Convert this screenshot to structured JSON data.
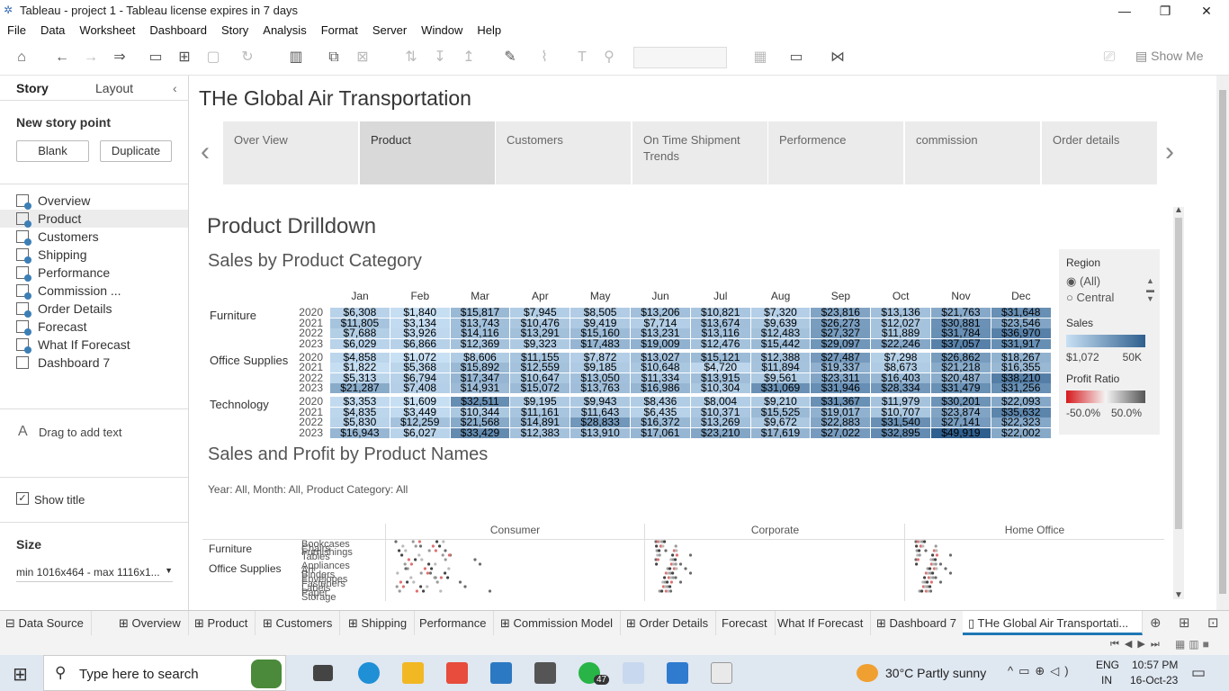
{
  "window": {
    "title": "Tableau - project 1 - Tableau license expires in 7 days",
    "minimize": "—",
    "restore": "❐",
    "close": "✕"
  },
  "menu": [
    "File",
    "Data",
    "Worksheet",
    "Dashboard",
    "Story",
    "Analysis",
    "Format",
    "Server",
    "Window",
    "Help"
  ],
  "toolbar": {
    "show_me": "Show Me"
  },
  "sidebar": {
    "tab_story": "Story",
    "tab_layout": "Layout",
    "collapse": "‹",
    "new_point": "New story point",
    "blank": "Blank",
    "duplicate": "Duplicate",
    "items": [
      "Overview",
      "Product",
      "Customers",
      "Shipping",
      "Performance",
      "Commission ...",
      "Order Details",
      "Forecast",
      "What If Forecast",
      "Dashboard 7"
    ],
    "drag_text": "Drag to add text",
    "show_title": "Show title",
    "size_label": "Size",
    "size_value": "min 1016x464 - max 1116x1..."
  },
  "story": {
    "title": "THe Global Air Transportation",
    "points": [
      {
        "label": "Over View"
      },
      {
        "label": "Product"
      },
      {
        "label": "Customers"
      },
      {
        "label": "On Time Shipment Trends"
      },
      {
        "label": "Performence"
      },
      {
        "label": "commission"
      },
      {
        "label": "Order details"
      }
    ],
    "prev": "‹",
    "next": "›"
  },
  "dashboard": {
    "title": "Product Drilldown",
    "heatmap_title": "Sales by Product Category",
    "scatter_title": "Sales and Profit by Product Names",
    "filter_text": "Year: All, Month: All, Product Category: All",
    "segments": [
      "Consumer",
      "Corporate",
      "Home Office"
    ],
    "scatter_rows": [
      {
        "label": "Furniture",
        "subs": [
          "Bookcases",
          "Chairs",
          "Furnishings",
          "Tables"
        ]
      },
      {
        "label": "Office Supplies",
        "subs": [
          "Appliances",
          "Art",
          "Binders",
          "Envelopes",
          "Fasteners",
          "Labels",
          "Paper",
          "Storage"
        ]
      }
    ]
  },
  "legend": {
    "region_label": "Region",
    "region_opts": [
      "(All)",
      "Central"
    ],
    "sales_label": "Sales",
    "sales_min": "$1,072",
    "sales_max": "50K",
    "profit_label": "Profit Ratio",
    "profit_min": "-50.0%",
    "profit_max": "50.0%"
  },
  "chart_data": {
    "type": "heatmap",
    "title": "Sales by Product Category",
    "months": [
      "Jan",
      "Feb",
      "Mar",
      "Apr",
      "May",
      "Jun",
      "Jul",
      "Aug",
      "Sep",
      "Oct",
      "Nov",
      "Dec"
    ],
    "categories": [
      {
        "name": "Furniture",
        "rows": [
          {
            "year": "2020",
            "values": [
              "$6,308",
              "$1,840",
              "$15,817",
              "$7,945",
              "$8,505",
              "$13,206",
              "$10,821",
              "$7,320",
              "$23,816",
              "$13,136",
              "$21,763",
              "$31,648"
            ]
          },
          {
            "year": "2021",
            "values": [
              "$11,805",
              "$3,134",
              "$13,743",
              "$10,476",
              "$9,419",
              "$7,714",
              "$13,674",
              "$9,639",
              "$26,273",
              "$12,027",
              "$30,881",
              "$23,546"
            ]
          },
          {
            "year": "2022",
            "values": [
              "$7,688",
              "$3,926",
              "$14,116",
              "$13,291",
              "$15,160",
              "$13,231",
              "$13,116",
              "$12,483",
              "$27,327",
              "$11,889",
              "$31,784",
              "$36,970"
            ]
          },
          {
            "year": "2023",
            "values": [
              "$6,029",
              "$6,866",
              "$12,369",
              "$9,323",
              "$17,483",
              "$19,009",
              "$12,476",
              "$15,442",
              "$29,097",
              "$22,246",
              "$37,057",
              "$31,917"
            ]
          }
        ]
      },
      {
        "name": "Office Supplies",
        "rows": [
          {
            "year": "2020",
            "values": [
              "$4,858",
              "$1,072",
              "$8,606",
              "$11,155",
              "$7,872",
              "$13,027",
              "$15,121",
              "$12,388",
              "$27,487",
              "$7,298",
              "$26,862",
              "$18,267"
            ]
          },
          {
            "year": "2021",
            "values": [
              "$1,822",
              "$5,368",
              "$15,892",
              "$12,559",
              "$9,185",
              "$10,648",
              "$4,720",
              "$11,894",
              "$19,337",
              "$8,673",
              "$21,218",
              "$16,355"
            ]
          },
          {
            "year": "2022",
            "values": [
              "$5,313",
              "$6,794",
              "$17,347",
              "$10,647",
              "$13,050",
              "$11,334",
              "$13,915",
              "$9,561",
              "$23,311",
              "$16,403",
              "$20,487",
              "$38,210"
            ]
          },
          {
            "year": "2023",
            "values": [
              "$21,287",
              "$7,408",
              "$14,931",
              "$15,072",
              "$13,763",
              "$16,986",
              "$10,304",
              "$31,069",
              "$31,946",
              "$28,334",
              "$31,479",
              "$31,256"
            ]
          }
        ]
      },
      {
        "name": "Technology",
        "rows": [
          {
            "year": "2020",
            "values": [
              "$3,353",
              "$1,609",
              "$32,511",
              "$9,195",
              "$9,943",
              "$8,436",
              "$8,004",
              "$9,210",
              "$31,367",
              "$11,979",
              "$30,201",
              "$22,093"
            ]
          },
          {
            "year": "2021",
            "values": [
              "$4,835",
              "$3,449",
              "$10,344",
              "$11,161",
              "$11,643",
              "$6,435",
              "$10,371",
              "$15,525",
              "$19,017",
              "$10,707",
              "$23,874",
              "$35,632"
            ]
          },
          {
            "year": "2022",
            "values": [
              "$5,830",
              "$12,259",
              "$21,568",
              "$14,891",
              "$28,833",
              "$16,372",
              "$13,269",
              "$9,672",
              "$22,883",
              "$31,540",
              "$27,141",
              "$22,323"
            ]
          },
          {
            "year": "2023",
            "values": [
              "$16,943",
              "$6,027",
              "$33,429",
              "$12,383",
              "$13,910",
              "$17,061",
              "$23,210",
              "$17,619",
              "$27,022",
              "$32,895",
              "$49,919",
              "$22,002"
            ]
          }
        ]
      }
    ],
    "color_range": [
      "#a9cde9",
      "#2f5f8e"
    ]
  },
  "tabs": [
    "Data Source",
    "Overview",
    "Product",
    "Customers",
    "Shipping",
    "Performance",
    "Commission Model",
    "Order Details",
    "Forecast",
    "What If Forecast",
    "Dashboard 7",
    "THe Global Air Transportati..."
  ],
  "taskbar": {
    "search": "Type here to search",
    "weather": "30°C  Partly sunny",
    "lang1": "ENG",
    "lang2": "IN",
    "time": "10:57 PM",
    "date": "16-Oct-23",
    "badge": "47"
  }
}
